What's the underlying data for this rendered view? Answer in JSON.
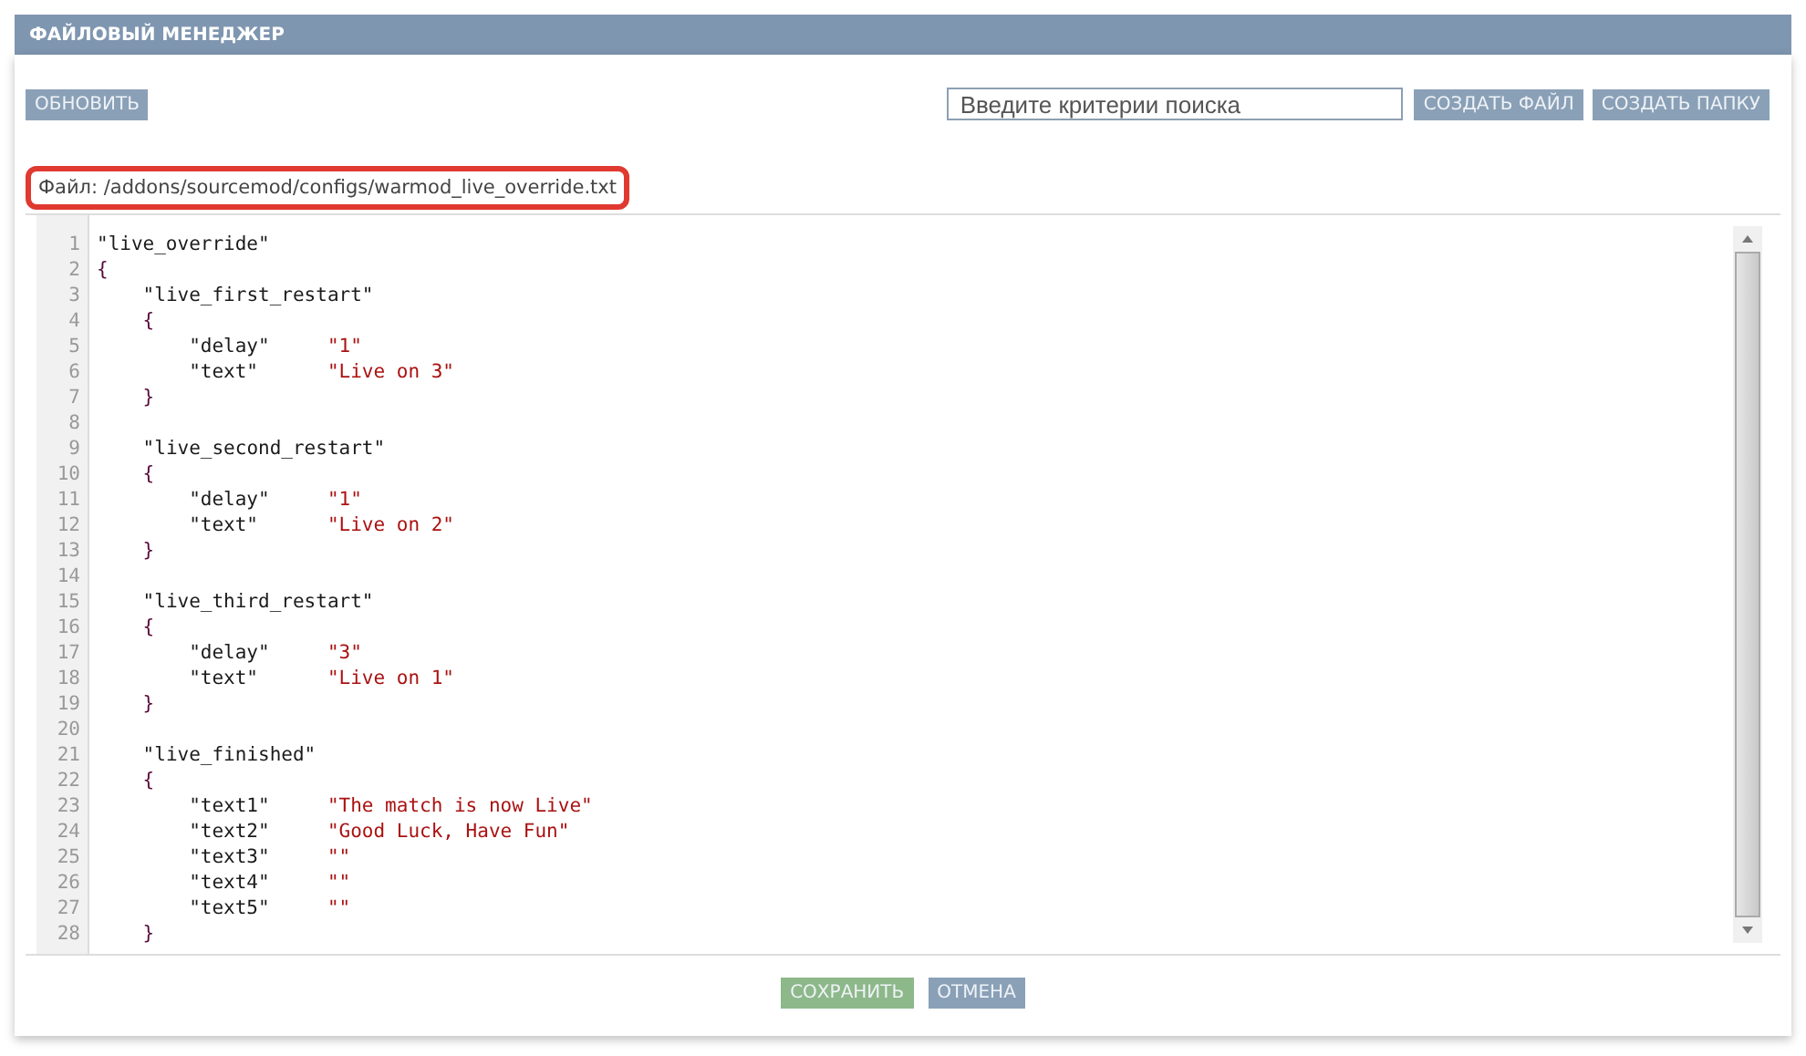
{
  "window": {
    "title": "ФАЙЛОВЫЙ МЕНЕДЖЕР"
  },
  "toolbar": {
    "refresh_button": "ОБНОВИТЬ",
    "search": {
      "placeholder": "Введите критерии поиска"
    },
    "buttons": [
      "СОЗДАТЬ ФАЙЛ",
      "СОЗДАТЬ ПАПКУ"
    ]
  },
  "file_label": {
    "text": "Файл: /addons/sourcemod/configs/warmod_live_override.txt",
    "highlighted": true
  },
  "editor": {
    "lines": [
      {
        "number": "1",
        "code": "\"live_override\""
      },
      {
        "number": "2",
        "code": "{"
      },
      {
        "number": "3",
        "code": "    \"live_first_restart\""
      },
      {
        "number": "4",
        "code": "    {"
      },
      {
        "number": "5",
        "code": "        \"delay\"     \"1\""
      },
      {
        "number": "6",
        "code": "        \"text\"      \"Live on 3\""
      },
      {
        "number": "7",
        "code": "    }"
      },
      {
        "number": "8"
      },
      {
        "number": "9",
        "code": "    \"live_second_restart\""
      },
      {
        "number": "10",
        "code": "    {"
      },
      {
        "number": "11",
        "code": "        \"delay\"     \"1\""
      },
      {
        "number": "12",
        "code": "        \"text\"      \"Live on 2\""
      },
      {
        "number": "13",
        "code": "    }"
      },
      {
        "number": "14"
      },
      {
        "number": "15",
        "code": "    \"live_third_restart\""
      },
      {
        "number": "16",
        "code": "    {"
      },
      {
        "number": "17",
        "code": "        \"delay\"     \"3\""
      },
      {
        "number": "18",
        "code": "        \"text\"      \"Live on 1\""
      },
      {
        "number": "19",
        "code": "    }"
      },
      {
        "number": "20"
      },
      {
        "number": "21",
        "code": "    \"live_finished\""
      },
      {
        "number": "22",
        "code": "    {"
      },
      {
        "number": "23",
        "code": "        \"text1\"     \"The match is now Live\""
      },
      {
        "number": "24",
        "code": "        \"text2\"     \"Good Luck, Have Fun\""
      },
      {
        "number": "25",
        "code": "        \"text3\"     \"\""
      },
      {
        "number": "26",
        "code": "        \"text4\"     \"\""
      },
      {
        "number": "27",
        "code": "        \"text5\"     \"\""
      },
      {
        "number": "28",
        "code": "    }"
      }
    ]
  },
  "footer": {
    "buttons": [
      {
        "label": "СОХРАНИТЬ",
        "kind": "primary"
      },
      {
        "label": "ОТМЕНА",
        "kind": "secondary"
      }
    ]
  }
}
